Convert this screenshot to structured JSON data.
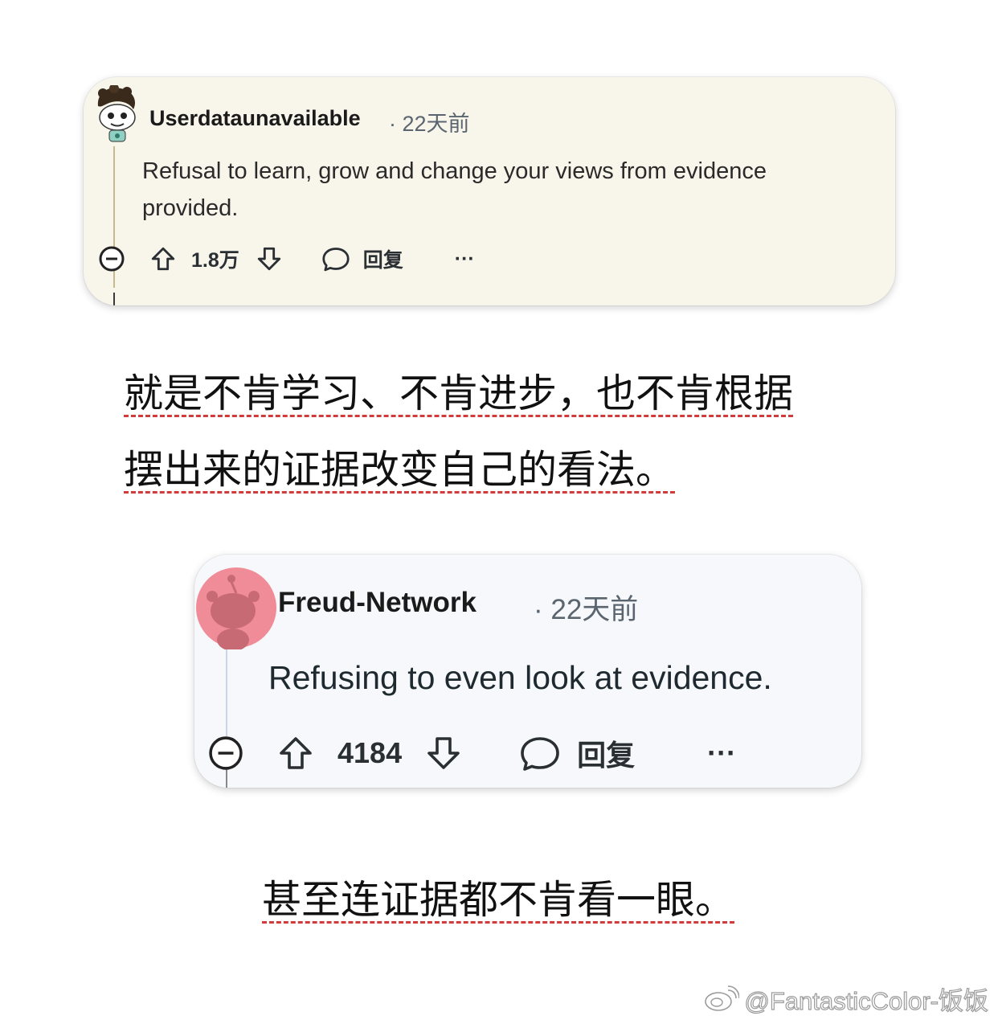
{
  "comment1": {
    "username": "Userdataunavailable",
    "time": "· 22天前",
    "text": "Refusal to learn, grow and change your views from evidence provided.",
    "upvotes": "1.8万",
    "reply_label": "回复",
    "more": "···"
  },
  "caption1": {
    "line1": "就是不肯学习、不肯进步，也不肯根据",
    "line2": "摆出来的证据改变自己的看法。"
  },
  "comment2": {
    "username": "Freud-Network",
    "time": "· 22天前",
    "text": "Refusing to even look at evidence.",
    "upvotes": "4184",
    "reply_label": "回复",
    "more": "···"
  },
  "caption2": {
    "line1": "甚至连证据都不肯看一眼。"
  },
  "watermark": "@FantasticColor-饭饭",
  "colors": {
    "card1_bg": "#f8f5eb",
    "card2_bg": "#f6f8fb",
    "underline": "#d13b3b",
    "avatar2": "#f08c98"
  }
}
